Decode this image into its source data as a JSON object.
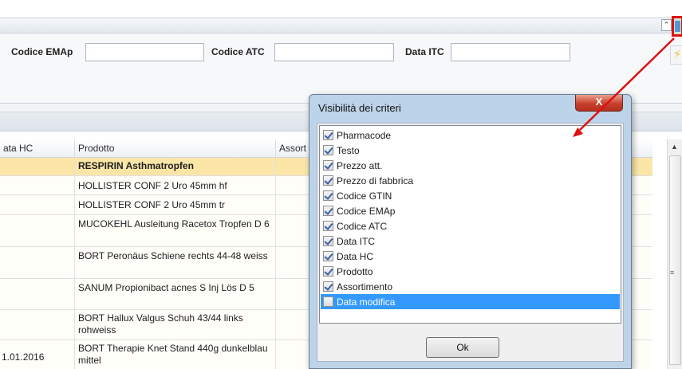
{
  "filters": {
    "fields": [
      {
        "label": "Codice EMAp",
        "value": ""
      },
      {
        "label": "Codice ATC",
        "value": ""
      },
      {
        "label": "Data ITC",
        "value": ""
      }
    ]
  },
  "grid": {
    "columns": [
      "ata HC",
      "Prodotto",
      "Assort"
    ],
    "rows": [
      {
        "date": "",
        "product": "RESPIRIN Asthmatropfen",
        "selected": true
      },
      {
        "date": "",
        "product": "HOLLISTER CONF 2 Uro 45mm hf"
      },
      {
        "date": "",
        "product": "HOLLISTER CONF 2 Uro 45mm tr"
      },
      {
        "date": "",
        "product": "MUCOKEHL Ausleitung Racetox Tropfen D 6"
      },
      {
        "date": "",
        "product": "BORT Peronäus Schiene rechts 44-48 weiss"
      },
      {
        "date": "",
        "product": "SANUM Propionibact acnes S Inj Lös D 5"
      },
      {
        "date": "",
        "product": "BORT Hallux Valgus Schuh 43/44 links rohweiss"
      },
      {
        "date": "1.01.2016",
        "product": "BORT Therapie Knet Stand 440g dunkelblau mittel"
      }
    ]
  },
  "dialog": {
    "title": "Visibilità dei criteri",
    "close_label": "X",
    "ok_label": "Ok",
    "items": [
      {
        "label": "Pharmacode",
        "checked": true
      },
      {
        "label": "Testo",
        "checked": true
      },
      {
        "label": "Prezzo att.",
        "checked": true
      },
      {
        "label": "Prezzo di fabbrica",
        "checked": true
      },
      {
        "label": "Codice GTIN",
        "checked": true
      },
      {
        "label": "Codice EMAp",
        "checked": true
      },
      {
        "label": "Codice ATC",
        "checked": true
      },
      {
        "label": "Data ITC",
        "checked": true
      },
      {
        "label": "Data HC",
        "checked": true
      },
      {
        "label": "Prodotto",
        "checked": true
      },
      {
        "label": "Assortimento",
        "checked": true
      },
      {
        "label": "Data modifica",
        "checked": false,
        "highlighted": true
      }
    ]
  },
  "icons": {
    "collapse": "double-chevron-up-icon",
    "criteria_visibility": "criteria-visibility-icon",
    "flash": "lightning-icon"
  },
  "colors": {
    "selected_row": "#fbe6a8",
    "highlight": "#3399ff",
    "annotation": "#e01010"
  }
}
